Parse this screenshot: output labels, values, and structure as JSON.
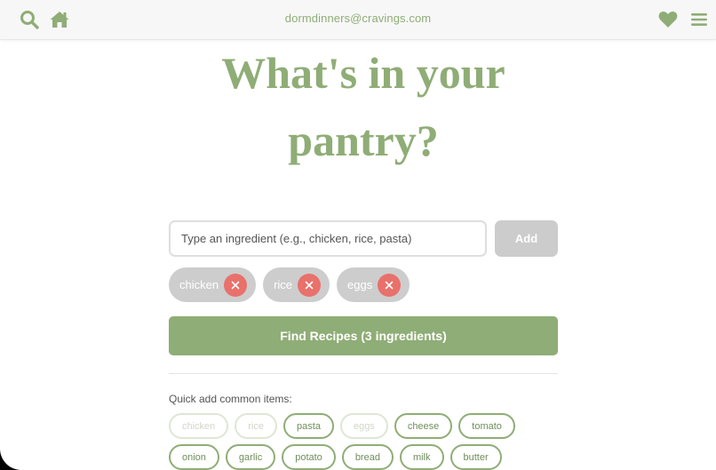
{
  "header": {
    "email": "dormdinners@cravings.com",
    "icons": {
      "search": "search-icon",
      "home": "home-icon",
      "favorites": "heart-icon",
      "menu": "menu-icon"
    }
  },
  "hero": {
    "title_line1": "What's in your",
    "title_line2": "pantry?"
  },
  "ingredient_input": {
    "value": "",
    "placeholder": "Type an ingredient (e.g., chicken, rice, pasta)"
  },
  "add_button": {
    "label": "Add",
    "enabled": false
  },
  "selected_ingredients": [
    {
      "label": "chicken"
    },
    {
      "label": "rice"
    },
    {
      "label": "eggs"
    }
  ],
  "find_button": {
    "label": "Find Recipes (3 ingredients)"
  },
  "quick_add": {
    "label": "Quick add common items:",
    "items": [
      {
        "label": "chicken",
        "disabled": true
      },
      {
        "label": "rice",
        "disabled": true
      },
      {
        "label": "pasta",
        "disabled": false
      },
      {
        "label": "eggs",
        "disabled": true
      },
      {
        "label": "cheese",
        "disabled": false
      },
      {
        "label": "tomato",
        "disabled": false
      },
      {
        "label": "onion",
        "disabled": false
      },
      {
        "label": "garlic",
        "disabled": false
      },
      {
        "label": "potato",
        "disabled": false
      },
      {
        "label": "bread",
        "disabled": false
      },
      {
        "label": "milk",
        "disabled": false
      },
      {
        "label": "butter",
        "disabled": false
      }
    ]
  },
  "colors": {
    "accent": "#8fad76",
    "chip_bg": "#cdcdcd",
    "remove": "#e9706b",
    "disabled_button": "#cccccc"
  }
}
